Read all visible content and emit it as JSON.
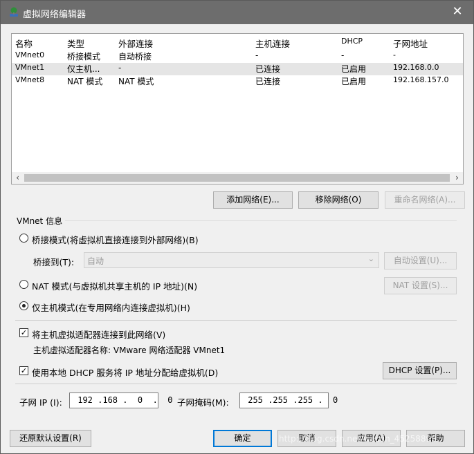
{
  "window": {
    "title": "虚拟网络编辑器",
    "close_symbol": "✕"
  },
  "table": {
    "headers": {
      "name": "名称",
      "type": "类型",
      "external": "外部连接",
      "host": "主机连接",
      "dhcp": "DHCP",
      "subnet": "子网地址"
    },
    "rows": [
      {
        "name": "VMnet0",
        "type": "桥接模式",
        "external": "自动桥接",
        "host": "-",
        "dhcp": "-",
        "subnet": "-"
      },
      {
        "name": "VMnet1",
        "type": "仅主机...",
        "external": "-",
        "host": "已连接",
        "dhcp": "已启用",
        "subnet": "192.168.0.0"
      },
      {
        "name": "VMnet8",
        "type": "NAT 模式",
        "external": "NAT 模式",
        "host": "已连接",
        "dhcp": "已启用",
        "subnet": "192.168.157.0"
      }
    ],
    "scroll_left": "‹",
    "scroll_right": "›"
  },
  "buttons": {
    "add_network": "添加网络(E)...",
    "remove_network": "移除网络(O)",
    "rename_network": "重命名网络(A)...",
    "auto_settings": "自动设置(U)...",
    "nat_settings": "NAT 设置(S)...",
    "dhcp_settings": "DHCP 设置(P)...",
    "restore_defaults": "还原默认设置(R)",
    "ok": "确定",
    "cancel": "取消",
    "apply": "应用(A)",
    "help": "帮助"
  },
  "vmnet_info": {
    "group_label": "VMnet 信息",
    "bridged_label": "桥接模式(将虚拟机直接连接到外部网络)(B)",
    "bridged_to_label": "桥接到(T):",
    "bridged_to_value": "自动",
    "nat_label": "NAT 模式(与虚拟机共享主机的 IP 地址)(N)",
    "host_only_label": "仅主机模式(在专用网络内连接虚拟机)(H)",
    "selected_mode": "host_only",
    "connect_adapter_label": "将主机虚拟适配器连接到此网络(V)",
    "connect_adapter_checked": true,
    "adapter_name_text": "主机虚拟适配器名称: VMware 网络适配器 VMnet1",
    "use_dhcp_label": "使用本地 DHCP 服务将 IP 地址分配给虚拟机(D)",
    "use_dhcp_checked": true,
    "subnet_ip_label": "子网 IP (I):",
    "subnet_ip_value": " 192 .168 .  0  .  0",
    "subnet_mask_label": "子网掩码(M):",
    "subnet_mask_value": " 255 .255 .255 .  0"
  },
  "watermark": "http://blog.csdn.net/weixin_45258890",
  "colors": {
    "titlebar": "#6d6d6d",
    "selected_row": "#e5e5e5",
    "focus_blue": "#0078d7",
    "dialog_bg": "#f0f0f0"
  }
}
